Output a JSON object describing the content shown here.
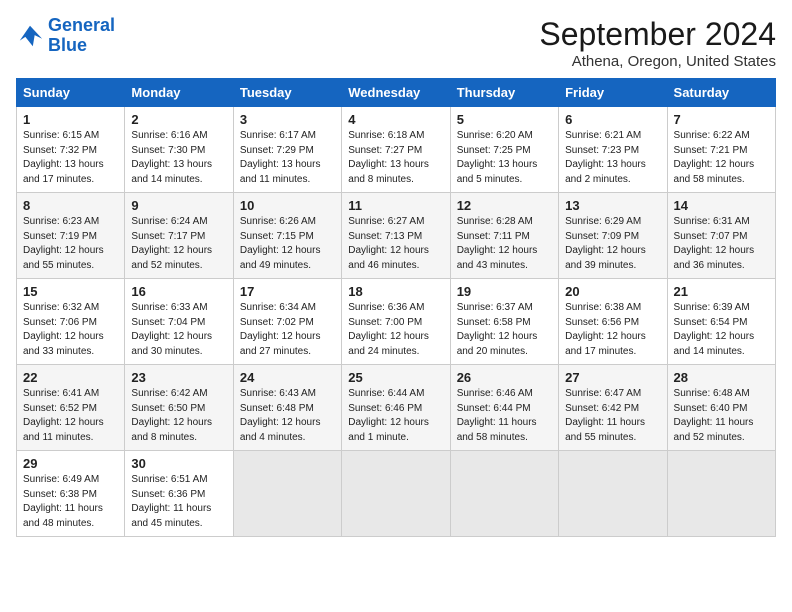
{
  "header": {
    "logo_line1": "General",
    "logo_line2": "Blue",
    "month_year": "September 2024",
    "location": "Athena, Oregon, United States"
  },
  "weekdays": [
    "Sunday",
    "Monday",
    "Tuesday",
    "Wednesday",
    "Thursday",
    "Friday",
    "Saturday"
  ],
  "weeks": [
    [
      {
        "day": "1",
        "info": "Sunrise: 6:15 AM\nSunset: 7:32 PM\nDaylight: 13 hours\nand 17 minutes."
      },
      {
        "day": "2",
        "info": "Sunrise: 6:16 AM\nSunset: 7:30 PM\nDaylight: 13 hours\nand 14 minutes."
      },
      {
        "day": "3",
        "info": "Sunrise: 6:17 AM\nSunset: 7:29 PM\nDaylight: 13 hours\nand 11 minutes."
      },
      {
        "day": "4",
        "info": "Sunrise: 6:18 AM\nSunset: 7:27 PM\nDaylight: 13 hours\nand 8 minutes."
      },
      {
        "day": "5",
        "info": "Sunrise: 6:20 AM\nSunset: 7:25 PM\nDaylight: 13 hours\nand 5 minutes."
      },
      {
        "day": "6",
        "info": "Sunrise: 6:21 AM\nSunset: 7:23 PM\nDaylight: 13 hours\nand 2 minutes."
      },
      {
        "day": "7",
        "info": "Sunrise: 6:22 AM\nSunset: 7:21 PM\nDaylight: 12 hours\nand 58 minutes."
      }
    ],
    [
      {
        "day": "8",
        "info": "Sunrise: 6:23 AM\nSunset: 7:19 PM\nDaylight: 12 hours\nand 55 minutes."
      },
      {
        "day": "9",
        "info": "Sunrise: 6:24 AM\nSunset: 7:17 PM\nDaylight: 12 hours\nand 52 minutes."
      },
      {
        "day": "10",
        "info": "Sunrise: 6:26 AM\nSunset: 7:15 PM\nDaylight: 12 hours\nand 49 minutes."
      },
      {
        "day": "11",
        "info": "Sunrise: 6:27 AM\nSunset: 7:13 PM\nDaylight: 12 hours\nand 46 minutes."
      },
      {
        "day": "12",
        "info": "Sunrise: 6:28 AM\nSunset: 7:11 PM\nDaylight: 12 hours\nand 43 minutes."
      },
      {
        "day": "13",
        "info": "Sunrise: 6:29 AM\nSunset: 7:09 PM\nDaylight: 12 hours\nand 39 minutes."
      },
      {
        "day": "14",
        "info": "Sunrise: 6:31 AM\nSunset: 7:07 PM\nDaylight: 12 hours\nand 36 minutes."
      }
    ],
    [
      {
        "day": "15",
        "info": "Sunrise: 6:32 AM\nSunset: 7:06 PM\nDaylight: 12 hours\nand 33 minutes."
      },
      {
        "day": "16",
        "info": "Sunrise: 6:33 AM\nSunset: 7:04 PM\nDaylight: 12 hours\nand 30 minutes."
      },
      {
        "day": "17",
        "info": "Sunrise: 6:34 AM\nSunset: 7:02 PM\nDaylight: 12 hours\nand 27 minutes."
      },
      {
        "day": "18",
        "info": "Sunrise: 6:36 AM\nSunset: 7:00 PM\nDaylight: 12 hours\nand 24 minutes."
      },
      {
        "day": "19",
        "info": "Sunrise: 6:37 AM\nSunset: 6:58 PM\nDaylight: 12 hours\nand 20 minutes."
      },
      {
        "day": "20",
        "info": "Sunrise: 6:38 AM\nSunset: 6:56 PM\nDaylight: 12 hours\nand 17 minutes."
      },
      {
        "day": "21",
        "info": "Sunrise: 6:39 AM\nSunset: 6:54 PM\nDaylight: 12 hours\nand 14 minutes."
      }
    ],
    [
      {
        "day": "22",
        "info": "Sunrise: 6:41 AM\nSunset: 6:52 PM\nDaylight: 12 hours\nand 11 minutes."
      },
      {
        "day": "23",
        "info": "Sunrise: 6:42 AM\nSunset: 6:50 PM\nDaylight: 12 hours\nand 8 minutes."
      },
      {
        "day": "24",
        "info": "Sunrise: 6:43 AM\nSunset: 6:48 PM\nDaylight: 12 hours\nand 4 minutes."
      },
      {
        "day": "25",
        "info": "Sunrise: 6:44 AM\nSunset: 6:46 PM\nDaylight: 12 hours\nand 1 minute."
      },
      {
        "day": "26",
        "info": "Sunrise: 6:46 AM\nSunset: 6:44 PM\nDaylight: 11 hours\nand 58 minutes."
      },
      {
        "day": "27",
        "info": "Sunrise: 6:47 AM\nSunset: 6:42 PM\nDaylight: 11 hours\nand 55 minutes."
      },
      {
        "day": "28",
        "info": "Sunrise: 6:48 AM\nSunset: 6:40 PM\nDaylight: 11 hours\nand 52 minutes."
      }
    ],
    [
      {
        "day": "29",
        "info": "Sunrise: 6:49 AM\nSunset: 6:38 PM\nDaylight: 11 hours\nand 48 minutes."
      },
      {
        "day": "30",
        "info": "Sunrise: 6:51 AM\nSunset: 6:36 PM\nDaylight: 11 hours\nand 45 minutes."
      },
      {
        "day": "",
        "info": ""
      },
      {
        "day": "",
        "info": ""
      },
      {
        "day": "",
        "info": ""
      },
      {
        "day": "",
        "info": ""
      },
      {
        "day": "",
        "info": ""
      }
    ]
  ]
}
